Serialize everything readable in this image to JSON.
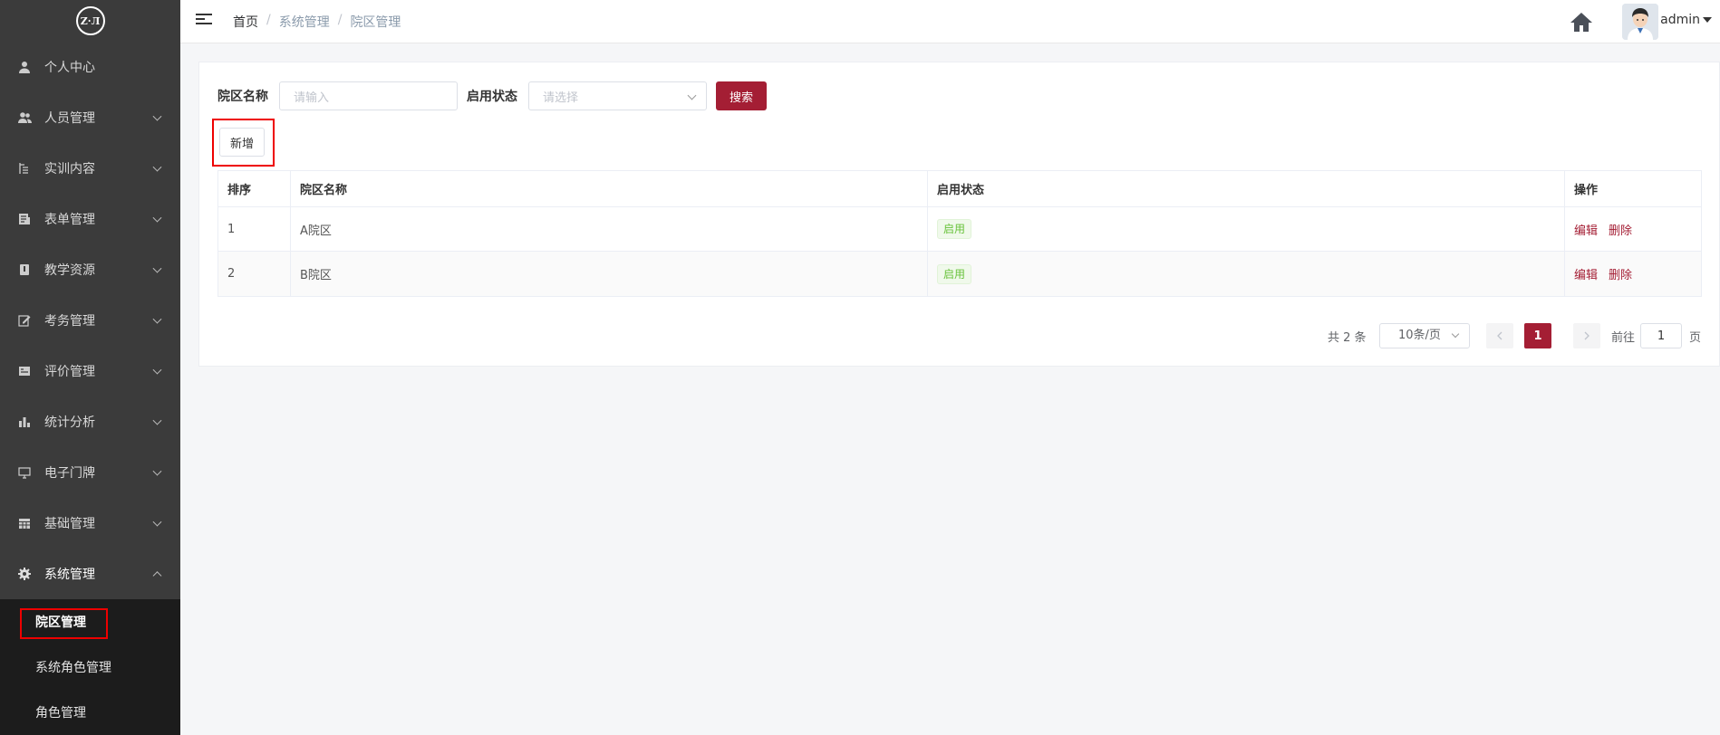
{
  "logo": {
    "text": "Z·Л"
  },
  "sidebar": {
    "items": [
      {
        "label": "个人中心",
        "icon": "user-icon",
        "has_children": false
      },
      {
        "label": "人员管理",
        "icon": "users-icon",
        "has_children": true
      },
      {
        "label": "实训内容",
        "icon": "list-icon",
        "has_children": true
      },
      {
        "label": "表单管理",
        "icon": "form-icon",
        "has_children": true
      },
      {
        "label": "教学资源",
        "icon": "book-icon",
        "has_children": true
      },
      {
        "label": "考务管理",
        "icon": "edit-icon",
        "has_children": true
      },
      {
        "label": "评价管理",
        "icon": "rating-icon",
        "has_children": true
      },
      {
        "label": "统计分析",
        "icon": "bar-chart-icon",
        "has_children": true
      },
      {
        "label": "电子门牌",
        "icon": "monitor-icon",
        "has_children": true
      },
      {
        "label": "基础管理",
        "icon": "grid-icon",
        "has_children": true
      },
      {
        "label": "系统管理",
        "icon": "gear-icon",
        "has_children": true,
        "open": true
      }
    ],
    "sub_items": [
      {
        "label": "院区管理",
        "active": true
      },
      {
        "label": "系统角色管理",
        "active": false
      },
      {
        "label": "角色管理",
        "active": false
      }
    ]
  },
  "breadcrumb": {
    "home": "首页",
    "level1": "系统管理",
    "level2": "院区管理",
    "separator": "/"
  },
  "user": {
    "name": "admin"
  },
  "search": {
    "name_label": "院区名称",
    "name_placeholder": "请输入",
    "status_label": "启用状态",
    "status_placeholder": "请选择",
    "search_button": "搜索"
  },
  "actions": {
    "add_button": "新增"
  },
  "table": {
    "columns": [
      "排序",
      "院区名称",
      "启用状态",
      "操作"
    ],
    "rows": [
      {
        "order": "1",
        "name": "A院区",
        "status": "启用",
        "edit": "编辑",
        "delete": "删除"
      },
      {
        "order": "2",
        "name": "B院区",
        "status": "启用",
        "edit": "编辑",
        "delete": "删除"
      }
    ]
  },
  "pagination": {
    "total_text": "共 2 条",
    "page_size": "10条/页",
    "current_page": "1",
    "goto_label": "前往",
    "goto_value": "1",
    "page_suffix": "页"
  },
  "colors": {
    "sidebar_bg": "#3b3b3b",
    "submenu_bg": "#1c1c1c",
    "primary": "#a41e34",
    "success": "#67c23a"
  }
}
